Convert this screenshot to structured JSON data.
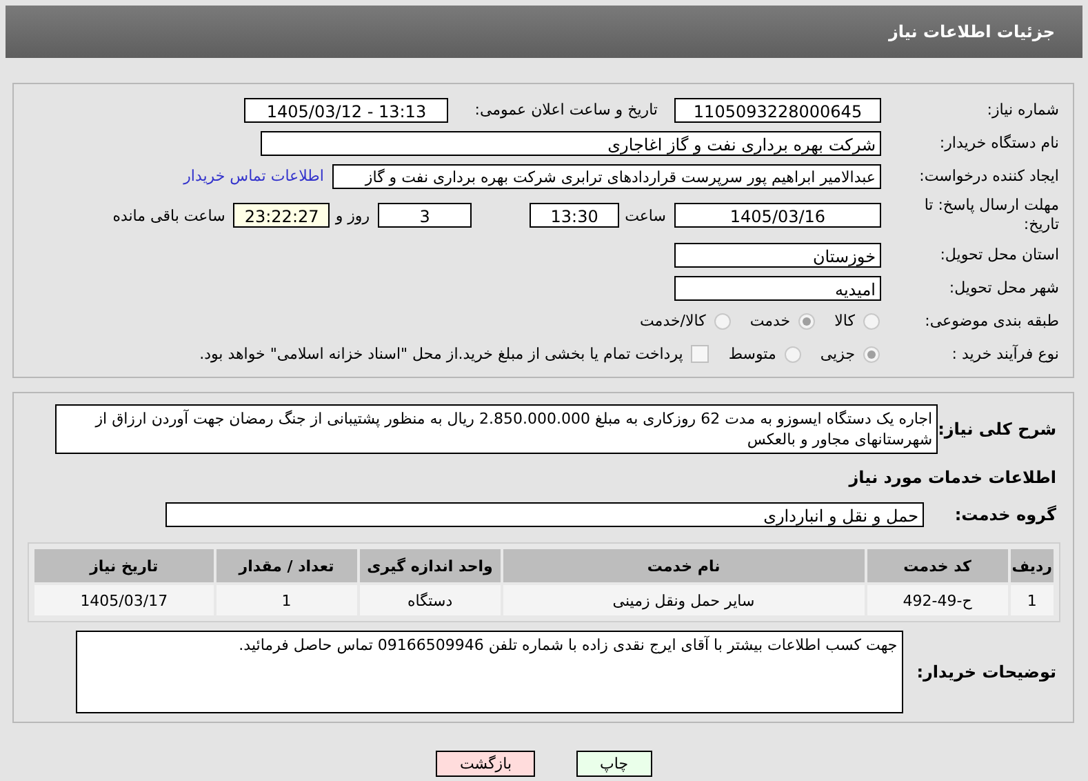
{
  "title": "جزئیات اطلاعات نیاز",
  "need_number": {
    "label": "شماره نیاز:",
    "value": "1105093228000645"
  },
  "announce": {
    "label": "تاریخ و ساعت اعلان عمومی:",
    "value": "1405/03/12 - 13:13"
  },
  "buyer": {
    "label": "نام دستگاه خریدار:",
    "value": "شرکت بهره برداری نفت و گاز اغاجاری"
  },
  "requester": {
    "label": "ایجاد کننده درخواست:",
    "value": "عبدالامیر ابراهیم پور سرپرست قراردادهای ترابری شرکت بهره برداری نفت و گاز",
    "link": "اطلاعات تماس خریدار"
  },
  "deadline": {
    "label": "مهلت ارسال پاسخ: تا تاریخ:",
    "date": "1405/03/16",
    "time_label": "ساعت",
    "time": "13:30",
    "days": "3",
    "days_label": "روز و",
    "remaining": "23:22:27",
    "remaining_label": "ساعت باقی مانده"
  },
  "province": {
    "label": "استان محل تحویل:",
    "value": "خوزستان"
  },
  "city": {
    "label": "شهر محل تحویل:",
    "value": "امیدیه"
  },
  "category": {
    "label": "طبقه بندی موضوعی:",
    "options": [
      {
        "label": "کالا",
        "selected": false
      },
      {
        "label": "خدمت",
        "selected": true
      },
      {
        "label": "کالا/خدمت",
        "selected": false
      }
    ]
  },
  "process": {
    "label": "نوع فرآیند خرید :",
    "options": [
      {
        "label": "جزیی",
        "selected": true
      },
      {
        "label": "متوسط",
        "selected": false
      }
    ],
    "treasury": {
      "label": "پرداخت تمام یا بخشی از مبلغ خرید.از محل \"اسناد خزانه اسلامی\" خواهد بود.",
      "checked": false
    }
  },
  "description": {
    "label": "شرح کلی نیاز:",
    "value": "اجاره یک دستگاه  ایسوزو به مدت 62 روزکاری  به مبلغ 2.850.000.000 ریال به منظور پشتیبانی از جنگ رمضان جهت آوردن ارزاق از شهرستانهای مجاور و بالعکس"
  },
  "services_heading": "اطلاعات خدمات مورد نیاز",
  "service_group": {
    "label": "گروه خدمت:",
    "value": "حمل و نقل و انبارداری"
  },
  "table": {
    "columns": [
      "ردیف",
      "کد خدمت",
      "نام خدمت",
      "واحد اندازه گیری",
      "تعداد / مقدار",
      "تاریخ نیاز"
    ],
    "rows": [
      [
        "1",
        "ح-49-492",
        "سایر حمل ونقل زمینی",
        "دستگاه",
        "1",
        "1405/03/17"
      ]
    ]
  },
  "buyer_notes": {
    "label": "توضیحات خریدار:",
    "value": "جهت کسب اطلاعات بیشتر با آقای ایرج نقدی زاده با شماره تلفن  09166509946 تماس حاصل فرمائید."
  },
  "buttons": [
    {
      "label": "چاپ",
      "kind": "print"
    },
    {
      "label": "بازگشت",
      "kind": "back"
    }
  ]
}
